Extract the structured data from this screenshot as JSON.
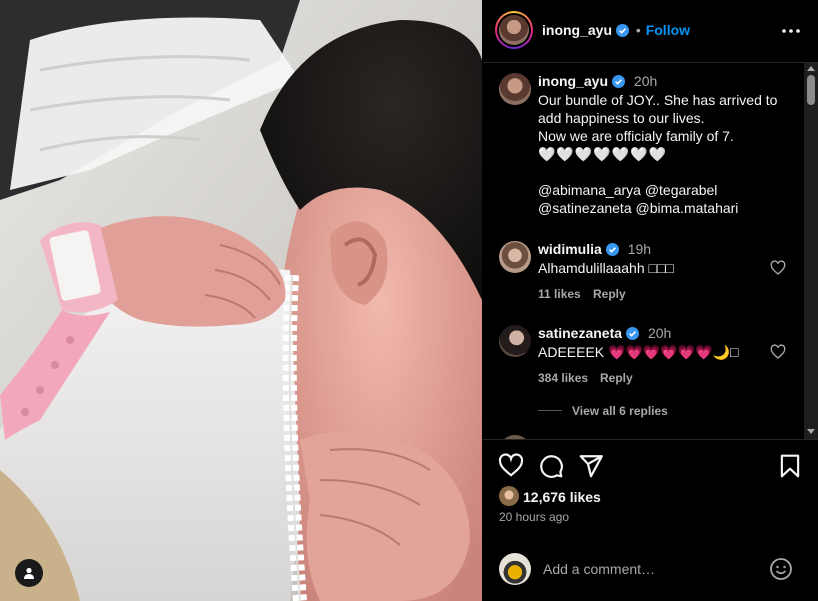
{
  "post_author": {
    "username": "inong_ayu",
    "follow_label": "Follow",
    "separator": "•"
  },
  "caption": {
    "username": "inong_ayu",
    "time": "20h",
    "lines": [
      "Our bundle of JOY.. She has arrived to",
      "add happiness to our lives.",
      "Now we are officialy family of 7.",
      "🤍🤍🤍🤍🤍🤍🤍",
      "",
      "@abimana_arya @tegarabel",
      "@satinezaneta @bima.matahari"
    ]
  },
  "comments": [
    {
      "username": "widimulia",
      "time": "19h",
      "text": "Alhamdulillaaahh □□□",
      "likes": "11 likes",
      "reply_label": "Reply"
    },
    {
      "username": "satinezaneta",
      "time": "20h",
      "text": "ADEEEEK 💗💗💗💗💗💗🌙□",
      "likes": "384 likes",
      "reply_label": "Reply",
      "view_replies": "View all 6 replies"
    }
  ],
  "stats": {
    "likes": "12,676 likes",
    "time_ago": "20 hours ago"
  },
  "comment_box": {
    "placeholder": "Add a comment…"
  },
  "colors": {
    "accent": "#0095f6",
    "verified": "#3897f0",
    "muted": "#a8a8a8",
    "heart_pink": "#e0245e"
  },
  "icons": {
    "more": "more-options-icon",
    "like": "heart-icon",
    "comment": "comment-icon",
    "share": "share-icon",
    "save": "bookmark-icon",
    "emoji": "emoji-icon",
    "tag": "user-tag-icon"
  }
}
